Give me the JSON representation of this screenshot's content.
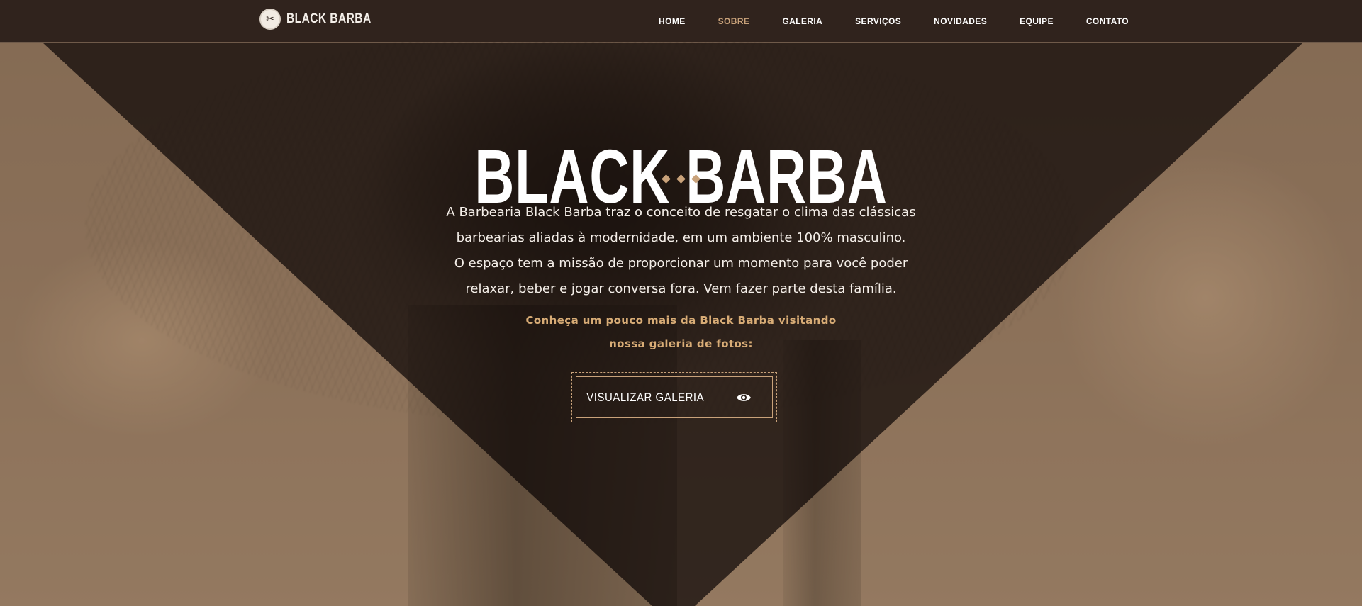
{
  "brand": {
    "logo_text": "BLACK BARBA",
    "icon": "barber-emblem-icon"
  },
  "nav": {
    "items": [
      {
        "label": "HOME"
      },
      {
        "label": "SOBRE"
      },
      {
        "label": "GALERIA"
      },
      {
        "label": "SERVIÇOS"
      },
      {
        "label": "NOVIDADES"
      },
      {
        "label": "EQUIPE"
      },
      {
        "label": "CONTATO"
      }
    ],
    "active": "SOBRE"
  },
  "hero": {
    "title": "BLACK BARBA",
    "description_lines": [
      "A Barbearia Black Barba traz o conceito de resgatar o clima das clássicas",
      "barbearias aliadas à modernidade, em um ambiente 100% masculino.",
      "O espaço tem a missão de proporcionar um momento para  você poder",
      "relaxar, beber e jogar conversa fora. Vem fazer parte desta família."
    ],
    "cta_lines": [
      "Conheça um pouco mais da Black Barba visitando",
      "nossa galeria de fotos:"
    ],
    "button_label": "VISUALIZAR GALERIA",
    "button_icon": "eye-icon"
  },
  "colors": {
    "navbar_bg": "#30231d",
    "accent": "#c9a27a",
    "cta_text": "#d8ac76",
    "text": "#ffffff"
  }
}
